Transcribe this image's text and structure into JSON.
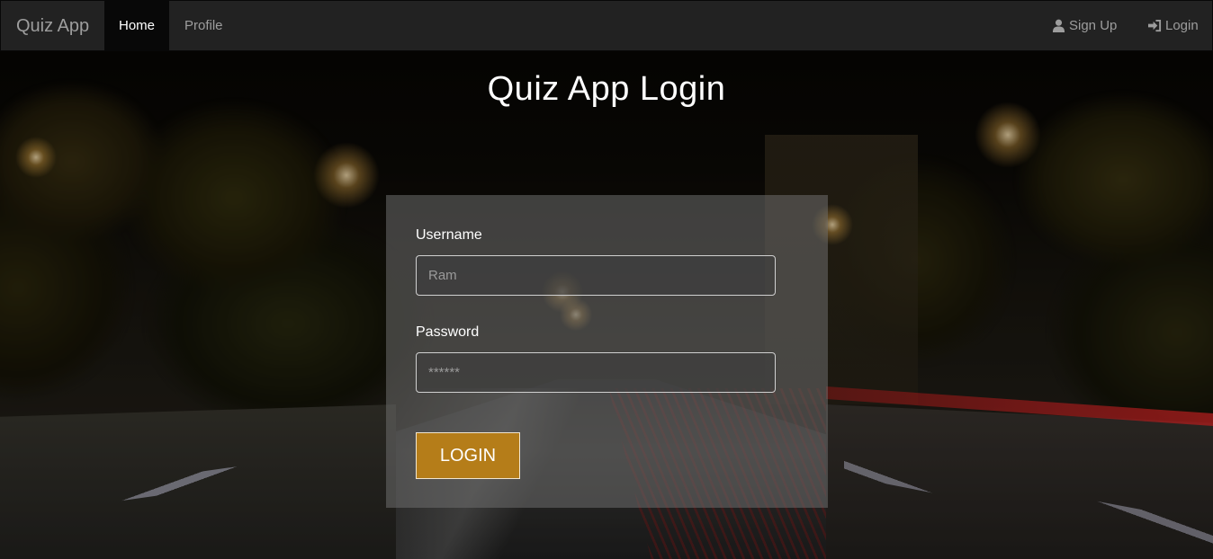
{
  "navbar": {
    "brand": "Quiz App",
    "links": [
      {
        "label": "Home",
        "active": true
      },
      {
        "label": "Profile",
        "active": false
      }
    ],
    "right_links": [
      {
        "label": "Sign Up",
        "icon": "user-icon"
      },
      {
        "label": "Login",
        "icon": "login-icon"
      }
    ]
  },
  "page": {
    "title": "Quiz App Login"
  },
  "form": {
    "username_label": "Username",
    "username_placeholder": "Ram",
    "password_label": "Password",
    "password_placeholder": "******",
    "submit_label": "LOGIN"
  },
  "colors": {
    "navbar_bg": "#222222",
    "active_nav_bg": "#080808",
    "button_bg": "#b57d19",
    "text": "#ffffff"
  }
}
